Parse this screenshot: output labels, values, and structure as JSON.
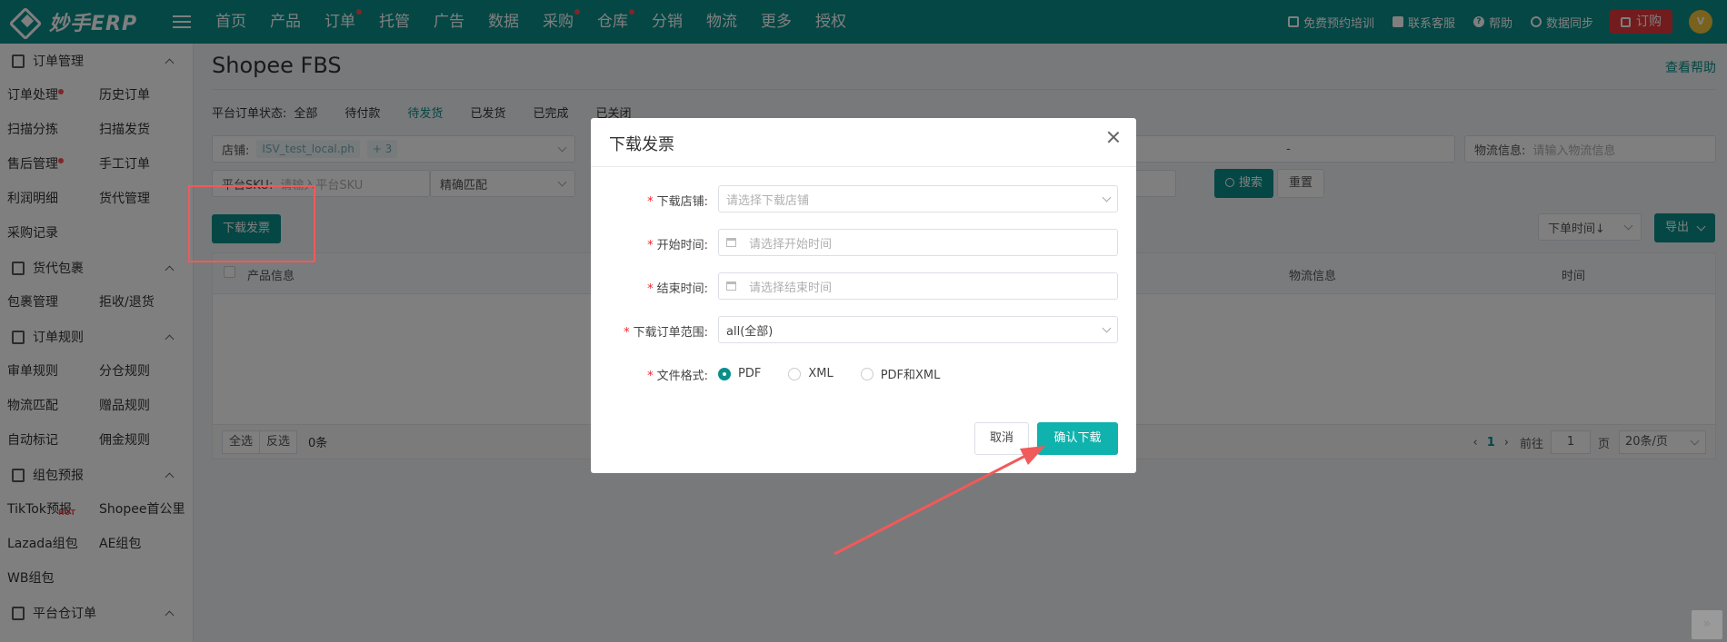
{
  "app": {
    "logo_text": "妙手ERP"
  },
  "topnav": [
    "首页",
    "产品",
    "订单",
    "托管",
    "广告",
    "数据",
    "采购",
    "仓库",
    "分销",
    "物流",
    "更多",
    "授权"
  ],
  "top_right": {
    "training": "免费预约培训",
    "support": "联系客服",
    "help": "帮助",
    "sync": "数据同步",
    "order": "订购",
    "avatar": "V"
  },
  "sidebar": [
    {
      "title": "订单管理",
      "items": [
        "订单处理",
        "历史订单",
        "扫描分拣",
        "扫描发货",
        "售后管理",
        "手工订单",
        "利润明细",
        "货代管理",
        "采购记录"
      ]
    },
    {
      "title": "货代包裹",
      "items": [
        "包裹管理",
        "拒收/退货"
      ]
    },
    {
      "title": "订单规则",
      "items": [
        "审单规则",
        "分仓规则",
        "物流匹配",
        "赠品规则",
        "自动标记",
        "佣金规则"
      ]
    },
    {
      "title": "组包预报",
      "items": [
        "TikTok预报",
        "Shopee首公里",
        "Lazada组包",
        "AE组包",
        "WB组包"
      ]
    },
    {
      "title": "平台仓订单",
      "items": []
    }
  ],
  "sidebar_hot": "HOT",
  "main": {
    "title": "Shopee FBS",
    "help_link": "查看帮助",
    "status_label": "平台订单状态:",
    "statuses": [
      "全部",
      "待付款",
      "待发货",
      "已发货",
      "已完成",
      "已关闭"
    ],
    "shop_label": "店铺:",
    "shop_tag": "ISV_test_local.ph",
    "shop_more": "+ 3",
    "sku_label": "平台SKU:",
    "sku_placeholder": "请输入平台SKU",
    "match_mode": "精确匹配",
    "range_sep": "-",
    "logistics_label": "物流信息:",
    "logistics_placeholder": "请输入物流信息",
    "search_btn": "搜索",
    "reset_btn": "重置",
    "download_invoice_btn": "下载发票",
    "sort_select": "下单时间↓",
    "export_btn": "导出",
    "columns": [
      "产品信息",
      "物流信息",
      "时间"
    ],
    "footer": {
      "select_all": "全选",
      "invert": "反选",
      "count": "0条",
      "page": "1",
      "goto": "前往",
      "goto_value": "1",
      "page_unit": "页",
      "page_size": "20条/页"
    }
  },
  "modal": {
    "title": "下载发票",
    "shop_label": "下载店铺:",
    "shop_placeholder": "请选择下载店铺",
    "start_label": "开始时间:",
    "start_placeholder": "请选择开始时间",
    "end_label": "结束时间:",
    "end_placeholder": "请选择结束时间",
    "range_label": "下载订单范围:",
    "range_value": "all(全部)",
    "format_label": "文件格式:",
    "formats": [
      "PDF",
      "XML",
      "PDF和XML"
    ],
    "selected_format": "PDF",
    "cancel": "取消",
    "confirm": "确认下载"
  },
  "colors": {
    "brand": "#0a8f8b",
    "confirm": "#10b2ad",
    "annotation": "#f05a5a",
    "order": "#e4393c"
  }
}
